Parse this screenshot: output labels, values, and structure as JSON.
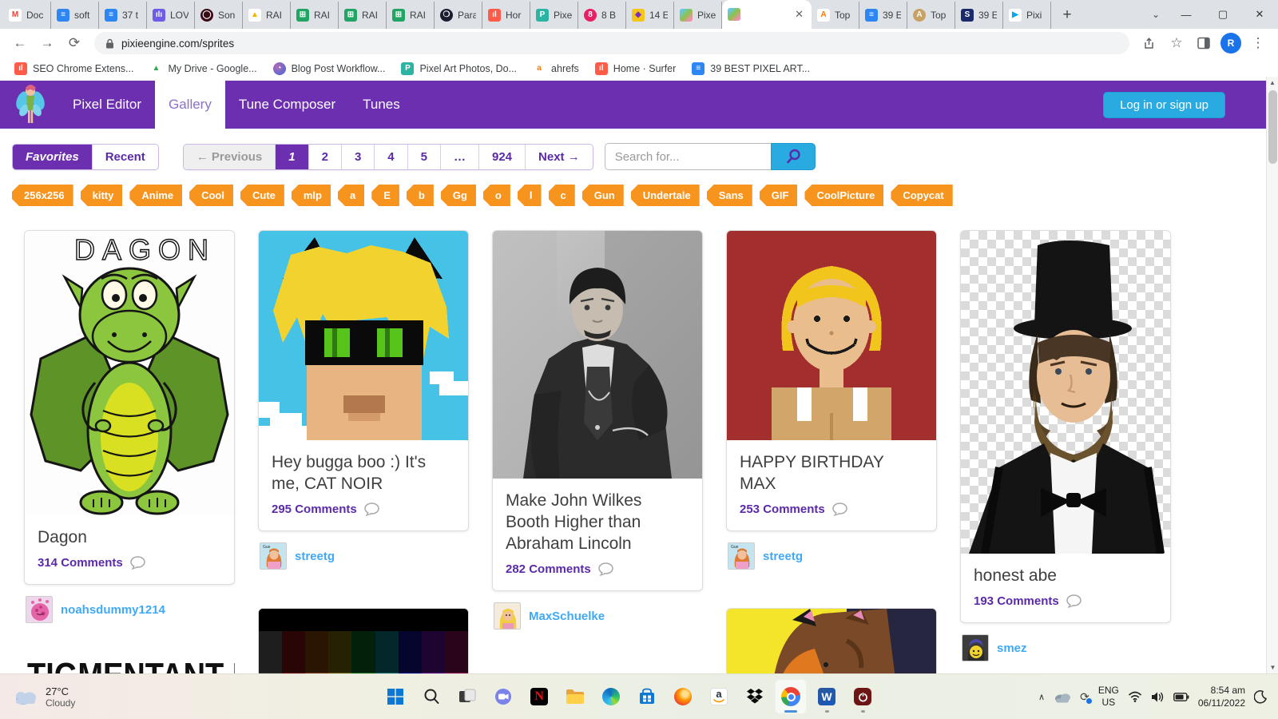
{
  "colors": {
    "accent_purple": "#6B2FAF",
    "cyan": "#29ABE2",
    "tag_orange": "#F7941E",
    "link_blue": "#3FA9F5",
    "comment_purple": "#5B2AA8"
  },
  "browser": {
    "tabs": [
      {
        "title": "Doc",
        "icon": "gmail-icon",
        "ibg": "#fff",
        "ilabel": "M",
        "ifg": "#EA4335"
      },
      {
        "title": "soft",
        "icon": "google-docs-icon",
        "ibg": "#2E86F5",
        "ilabel": "≡",
        "ifg": "#fff"
      },
      {
        "title": "37 t",
        "icon": "google-docs-icon",
        "ibg": "#2E86F5",
        "ilabel": "≡",
        "ifg": "#fff"
      },
      {
        "title": "LOV",
        "icon": "voice-notes-icon",
        "ibg": "#6C5CE7",
        "ilabel": "ılı",
        "ifg": "#fff"
      },
      {
        "title": "Son",
        "icon": "sonar-icon",
        "ibg": "#3A0A14",
        "ilabel": "◯",
        "ifg": "#fff",
        "shape": "round"
      },
      {
        "title": "RAI",
        "icon": "google-drive-icon",
        "ibg": "#fff",
        "ilabel": "▲",
        "ifg": "#F4B400"
      },
      {
        "title": "RAI",
        "icon": "google-sheets-icon",
        "ibg": "#21A464",
        "ilabel": "⊞",
        "ifg": "#fff"
      },
      {
        "title": "RAI",
        "icon": "google-sheets-icon",
        "ibg": "#21A464",
        "ilabel": "⊞",
        "ifg": "#fff"
      },
      {
        "title": "RAI",
        "icon": "google-sheets-icon",
        "ibg": "#21A464",
        "ilabel": "⊞",
        "ifg": "#fff"
      },
      {
        "title": "Para",
        "icon": "paradox-icon",
        "ibg": "#1C1C30",
        "ilabel": "❍",
        "ifg": "#fff",
        "shape": "round"
      },
      {
        "title": "Hor",
        "icon": "surfer-icon",
        "ibg": "#FF5B49",
        "ilabel": "ıl",
        "ifg": "#fff"
      },
      {
        "title": "Pixe",
        "icon": "pixel-photos-icon",
        "ibg": "#2BB3A3",
        "ilabel": "P",
        "ifg": "#fff"
      },
      {
        "title": "8 B",
        "icon": "eight-ball-icon",
        "ibg": "#E91E63",
        "ilabel": "8",
        "ifg": "#fff",
        "shape": "round"
      },
      {
        "title": "14 E",
        "icon": "gem-icon",
        "ibg": "#F5C518",
        "ilabel": "◆",
        "ifg": "#7B2FBE"
      },
      {
        "title": "Pixe",
        "icon": "fairy-icon",
        "ibg": "linear-gradient(135deg,#64C8E8 15%,#8BC34A 50%,#F48FB1 85%)",
        "ilabel": "",
        "ifg": "#fff"
      },
      {
        "title": "",
        "icon": "fairy-icon",
        "ibg": "linear-gradient(135deg,#64C8E8 15%,#8BC34A 50%,#F48FB1 85%)",
        "ilabel": "",
        "ifg": "#fff",
        "cls": "active",
        "close_label": "✕"
      },
      {
        "title": "Top",
        "icon": "ahrefs-flame-icon",
        "ibg": "#fff",
        "ilabel": "A",
        "ifg": "#FF7A00"
      },
      {
        "title": "39 E",
        "icon": "google-docs-icon",
        "ibg": "#2E86F5",
        "ilabel": "≡",
        "ifg": "#fff"
      },
      {
        "title": "Top",
        "icon": "gold-a-icon",
        "ibg": "#C8A165",
        "ilabel": "A",
        "ifg": "#fff",
        "shape": "round"
      },
      {
        "title": "39 E",
        "icon": "s-doc-icon",
        "ibg": "#1B2A6B",
        "ilabel": "S",
        "ifg": "#fff"
      },
      {
        "title": "Pixi",
        "icon": "google-play-icon",
        "ibg": "#fff",
        "ilabel": "▶",
        "ifg": "#00A8F0"
      }
    ],
    "new_tab_label": "+",
    "tab_search_chevron": "⌄",
    "window_controls": {
      "minimize": "—",
      "maximize": "▢",
      "close": "✕"
    },
    "nav": {
      "back": "←",
      "forward": "→",
      "reload": "⟳"
    },
    "omnibox": {
      "lock_icon": "🔒",
      "url": "pixieengine.com/sprites"
    },
    "toolbar_icons": {
      "share": "⇱",
      "bookmark_star": "☆",
      "side_panel": "▯",
      "menu": "⋮"
    },
    "profile_initial": "R",
    "bookmarks": [
      {
        "label": "SEO Chrome Extens...",
        "icon": "surfer-icon",
        "ibg": "#FF5B49",
        "ilabel": "ıl",
        "ifg": "#fff"
      },
      {
        "label": "My Drive - Google...",
        "icon": "google-drive-icon",
        "ibg": "#fff",
        "ilabel": "▲",
        "ifg": "#34A853"
      },
      {
        "label": "Blog Post Workflow...",
        "icon": "workflow-ring-icon",
        "ibg": "radial-gradient(circle at 30% 30%,#B06AB3,#4568DC)",
        "ilabel": "◔",
        "ifg": "#fff",
        "shape": "round"
      },
      {
        "label": "Pixel Art Photos, Do...",
        "icon": "pixel-photos-icon",
        "ibg": "#2BB3A3",
        "ilabel": "P",
        "ifg": "#fff"
      },
      {
        "label": "ahrefs",
        "icon": "ahrefs-icon",
        "ibg": "#fff",
        "ilabel": "a",
        "ifg": "#FF7A00"
      },
      {
        "label": "Home · Surfer",
        "icon": "surfer-icon",
        "ibg": "#FF5B49",
        "ilabel": "ıl",
        "ifg": "#fff"
      },
      {
        "label": "39 BEST PIXEL ART...",
        "icon": "google-docs-icon",
        "ibg": "#2E86F5",
        "ilabel": "≡",
        "ifg": "#fff"
      }
    ]
  },
  "site": {
    "nav": {
      "pixel_editor": "Pixel Editor",
      "gallery": "Gallery",
      "tune_composer": "Tune Composer",
      "tunes": "Tunes",
      "active": "Gallery"
    },
    "login_button": "Log in or sign up",
    "filters": {
      "favorites": "Favorites",
      "recent": "Recent",
      "active": "Favorites"
    },
    "pagination": {
      "previous": "← Previous",
      "pages": [
        {
          "label": "1",
          "cls": "sel"
        },
        {
          "label": "2"
        },
        {
          "label": "3"
        },
        {
          "label": "4"
        },
        {
          "label": "5"
        },
        {
          "label": "…"
        },
        {
          "label": "924"
        }
      ],
      "next": "Next →"
    },
    "search": {
      "placeholder": "Search for...",
      "button_icon": "magnifier-icon"
    },
    "tags": [
      {
        "label": "256x256"
      },
      {
        "label": "kitty"
      },
      {
        "label": "Anime"
      },
      {
        "label": "Cool"
      },
      {
        "label": "Cute"
      },
      {
        "label": "mlp"
      },
      {
        "label": "a"
      },
      {
        "label": "E"
      },
      {
        "label": "b"
      },
      {
        "label": "Gg"
      },
      {
        "label": "o"
      },
      {
        "label": "l"
      },
      {
        "label": "c"
      },
      {
        "label": "Gun"
      },
      {
        "label": "Undertale"
      },
      {
        "label": "Sans"
      },
      {
        "label": "GIF"
      },
      {
        "label": "CoolPicture"
      },
      {
        "label": "Copycat"
      }
    ],
    "cards": [
      {
        "title": "Dagon",
        "comments": "314 Comments",
        "author": "noahsdummy1214",
        "image": "dagon-dragon-drawing"
      },
      {
        "title": "Hey bugga boo :) It's me, CAT NOIR",
        "comments": "295 Comments",
        "author": "streetg",
        "image": "cat-noir-pixel-art"
      },
      {
        "title": "Make John Wilkes Booth Higher than Abraham Lincoln",
        "comments": "282 Comments",
        "author": "MaxSchuelke",
        "image": "john-wilkes-booth-photo"
      },
      {
        "title": "HAPPY BIRTHDAY MAX",
        "comments": "253 Comments",
        "author": "streetg",
        "image": "blond-boy-pixel-art"
      },
      {
        "title": "honest abe",
        "comments": "193 Comments",
        "author": "smez",
        "image": "abraham-lincoln-costume-photo"
      }
    ],
    "partials": {
      "clipped_title": "TIGMENTANT ME"
    }
  },
  "taskbar": {
    "weather": {
      "temp": "27°C",
      "condition": "Cloudy"
    },
    "icons": [
      "windows-start",
      "search",
      "task-view",
      "chat",
      "netflix",
      "file-explorer",
      "edge",
      "microsoft-store",
      "firefox",
      "amazon",
      "dropbox",
      "chrome",
      "word",
      "power"
    ],
    "tray": {
      "chevron": "∧",
      "language_line1": "ENG",
      "language_line2": "US",
      "time": "8:54 am",
      "date": "06/11/2022",
      "tray_icons": [
        "onedrive-icon",
        "sync-icon",
        "wifi-icon",
        "volume-icon",
        "battery-icon",
        "night-light-icon"
      ]
    }
  }
}
